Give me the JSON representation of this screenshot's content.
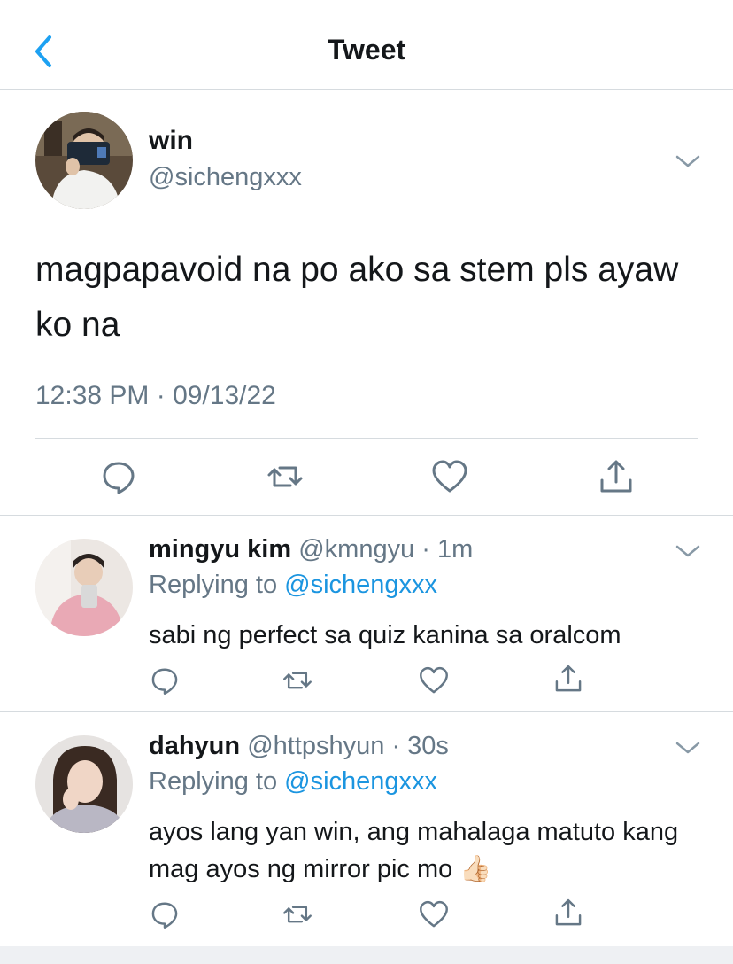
{
  "header": {
    "title": "Tweet"
  },
  "main_tweet": {
    "name": "win",
    "handle": "@sichengxxx",
    "text": "magpapavoid na po ako sa stem pls ayaw ko na",
    "timestamp": "12:38 PM · 09/13/22"
  },
  "replies": [
    {
      "name": "mingyu kim",
      "handle": "@kmngyu",
      "time": "1m",
      "replying_label": "Replying to",
      "replying_to": "@sichengxxx",
      "text": "sabi ng perfect sa quiz kanina sa oralcom"
    },
    {
      "name": "dahyun",
      "handle": "@httpshyun",
      "time": "30s",
      "replying_label": "Replying to",
      "replying_to": "@sichengxxx",
      "text": "ayos lang yan win, ang mahalaga matuto kang mag ayos ng mirror pic mo 👍🏻"
    }
  ],
  "icons": [
    "back-chevron-icon",
    "chevron-down-icon",
    "reply-icon",
    "retweet-icon",
    "like-icon",
    "share-icon"
  ],
  "colors": {
    "accent": "#1da1f2",
    "mention": "#1b95e0",
    "secondary_text": "#657786",
    "icon": "#657786",
    "divider": "#d6dbdf"
  }
}
